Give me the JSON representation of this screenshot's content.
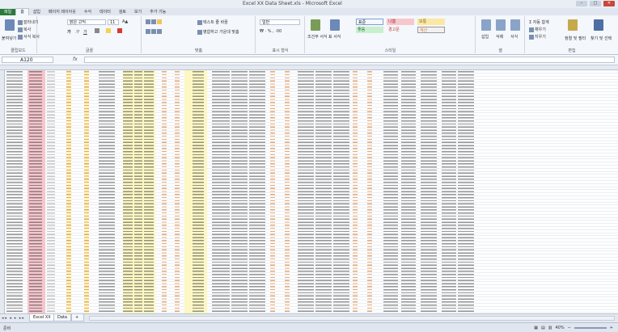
{
  "window": {
    "title": "Excel XX Data Sheet.xls - Microsoft Excel",
    "min": "–",
    "max": "□",
    "close": "✕"
  },
  "tabs": [
    "파일",
    "홈",
    "삽입",
    "페이지 레이아웃",
    "수식",
    "데이터",
    "검토",
    "보기",
    "추가 기능"
  ],
  "ribbon": {
    "clipboard": {
      "paste": "붙여넣기",
      "cut": "잘라내기",
      "copy": "복사",
      "format_painter": "서식 복사",
      "label": "클립보드"
    },
    "font": {
      "name": "맑은 고딕",
      "size": "11",
      "bold": "가",
      "italic": "가",
      "underline": "가",
      "label": "글꼴"
    },
    "alignment": {
      "wrap": "텍스트 줄 바꿈",
      "merge": "병합하고 가운데 맞춤",
      "label": "맞춤"
    },
    "number": {
      "format": "일반",
      "label": "표시 형식"
    },
    "styles": {
      "conditional": "조건부 서식",
      "table": "표 서식",
      "label": "스타일",
      "cells": [
        {
          "text": "표준",
          "bg": "#ffffff"
        },
        {
          "text": "나쁨",
          "bg": "#f7c7ce"
        },
        {
          "text": "보통",
          "bg": "#fbe9a3"
        },
        {
          "text": "좋음",
          "bg": "#c9efcf"
        },
        {
          "text": "경고문",
          "bg": "#ffffff"
        },
        {
          "text": "계산",
          "bg": "#f1f1f1"
        }
      ]
    },
    "cells": {
      "insert": "삽입",
      "delete": "삭제",
      "format": "서식",
      "label": "셀"
    },
    "editing": {
      "autosum": "자동 합계",
      "fill": "채우기",
      "clear": "지우기",
      "sort": "정렬 및 필터",
      "find": "찾기 및 선택",
      "label": "편집"
    }
  },
  "formula_bar": {
    "name_box": "A120",
    "fx": "fx",
    "value": ""
  },
  "sheets": [
    {
      "label": "Excel XX"
    },
    {
      "label": "Data"
    }
  ],
  "status": {
    "ready": "준비",
    "zoom": "40%"
  },
  "colors": {
    "pink_band": "#f6c6cd",
    "yellow_band": "#fdf7c4",
    "orange_text": "#d9813c"
  }
}
